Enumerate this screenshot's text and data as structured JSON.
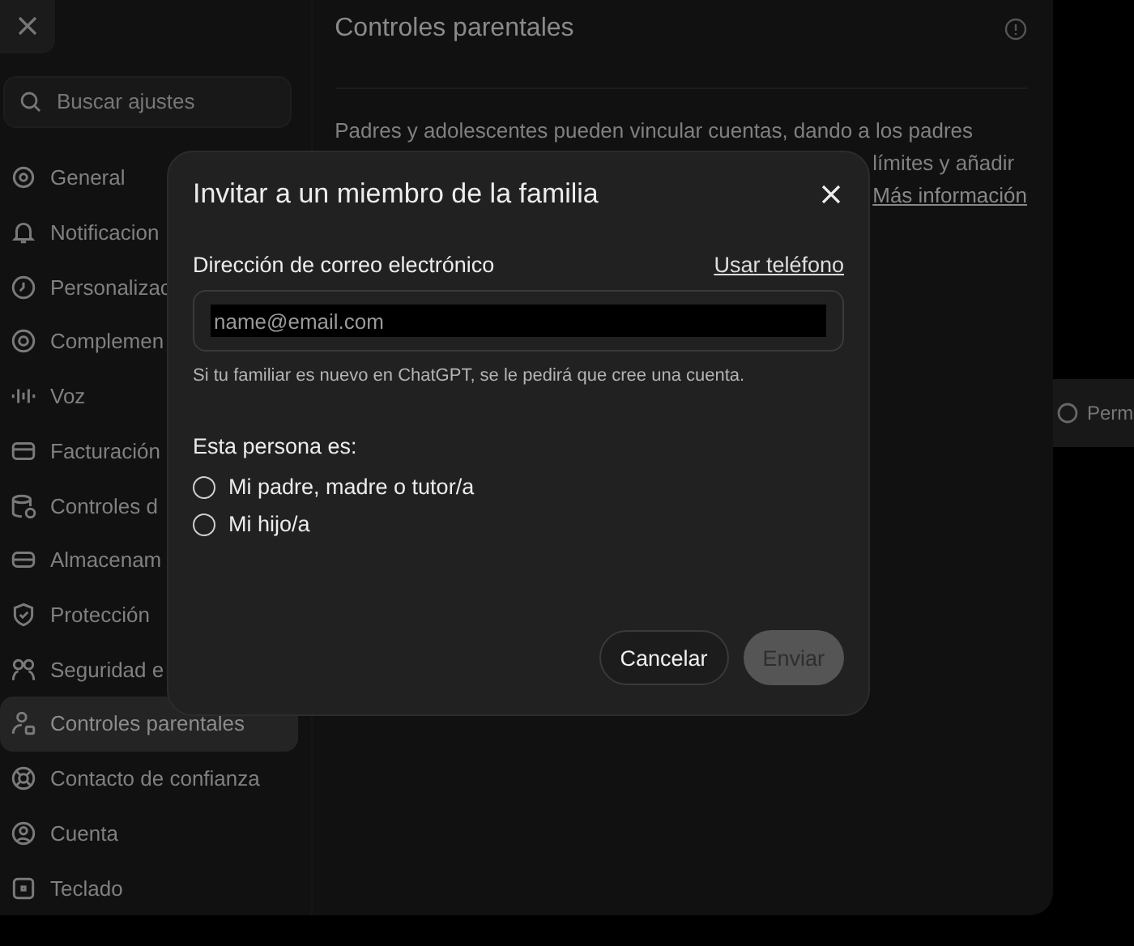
{
  "settings": {
    "title": "Controles parentales",
    "search": {
      "placeholder": "Buscar ajustes"
    },
    "sidebar": {
      "items": [
        {
          "label": "General",
          "selected": false
        },
        {
          "label": "Notificacion",
          "selected": false
        },
        {
          "label": "Personalizac",
          "selected": false
        },
        {
          "label": "Complemen",
          "selected": false
        },
        {
          "label": "Voz",
          "selected": false
        },
        {
          "label": "Facturación",
          "selected": false
        },
        {
          "label": "Controles d",
          "selected": false
        },
        {
          "label": "Almacenam",
          "selected": false
        },
        {
          "label": "Protección",
          "selected": false
        },
        {
          "label": "Seguridad e",
          "selected": false
        },
        {
          "label": "Controles parentales",
          "selected": true
        },
        {
          "label": "Contacto de confianza",
          "selected": false
        },
        {
          "label": "Cuenta",
          "selected": false
        },
        {
          "label": "Teclado",
          "selected": false
        }
      ]
    },
    "description_lines": [
      "Padres y adolescentes pueden vincular cuentas, dando a los padres",
      "límites y añadir"
    ],
    "learn_more": "Más información",
    "side_item": "Perm"
  },
  "dialog": {
    "title": "Invitar a un miembro de la familia",
    "email_label": "Dirección de correo electrónico",
    "use_phone": "Usar teléfono",
    "email_field": {
      "placeholder": "name@email.com"
    },
    "hint": "Si tu familiar es nuevo en ChatGPT, se le pedirá que cree una cuenta.",
    "question": "Esta persona es:",
    "options": [
      {
        "label": "Mi padre, madre o tutor/a",
        "selected": false
      },
      {
        "label": "Mi hijo/a",
        "selected": false
      }
    ],
    "buttons": [
      {
        "label": "Cancelar",
        "kind": "secondary",
        "disabled": false
      },
      {
        "label": "Enviar",
        "kind": "primary",
        "disabled": true
      }
    ]
  }
}
